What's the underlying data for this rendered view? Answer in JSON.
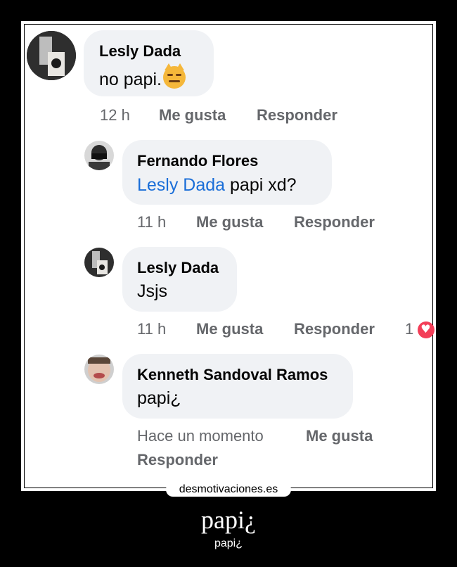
{
  "comments": [
    {
      "author": "Lesly Dada",
      "text": "no papi.",
      "emoji": "pouting-cat-emoji",
      "time": "12 h",
      "like": "Me gusta",
      "reply": "Responder"
    },
    {
      "author": "Fernando Flores",
      "mention": "Lesly Dada",
      "text": " papi xd?",
      "time": "11 h",
      "like": "Me gusta",
      "reply": "Responder"
    },
    {
      "author": "Lesly Dada",
      "text": "Jsjs",
      "time": "11 h",
      "like": "Me gusta",
      "reply": "Responder",
      "reaction_count": "1",
      "reaction_icon": "heart-reaction-icon"
    },
    {
      "author": "Kenneth Sandoval Ramos",
      "text": "papi¿",
      "time": "Hace un momento",
      "like": "Me gusta",
      "reply": "Responder"
    }
  ],
  "site": "desmotivaciones.es",
  "caption": {
    "title": "papi¿",
    "subtitle": "papi¿"
  },
  "colors": {
    "bubble": "#f0f2f5",
    "mention": "#1a6ed8",
    "meta": "#65676b",
    "heart": "#f33e58"
  }
}
